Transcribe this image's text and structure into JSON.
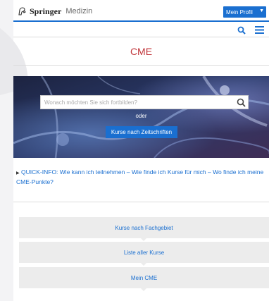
{
  "header": {
    "logo_brand": "Springer",
    "logo_sub": "Medizin",
    "profile_label": "Mein Profil",
    "profile_caret_icon": "caret-down-icon",
    "search_icon": "search-icon",
    "menu_icon": "hamburger-menu-icon"
  },
  "page": {
    "title": "CME"
  },
  "hero": {
    "search_placeholder": "Wonach möchten Sie sich fortbilden?",
    "or_label": "oder",
    "journals_button": "Kurse nach Zeitschriften"
  },
  "quickinfo": {
    "arrow": "▶",
    "text": "QUICK-INFO: Wie kann ich teilnehmen – Wie finde ich Kurse für mich – Wo finde ich meine CME-Punkte?"
  },
  "nav": {
    "items": [
      {
        "label": "Kurse nach Fachgebiet"
      },
      {
        "label": "Liste aller Kurse"
      },
      {
        "label": "Mein CME"
      }
    ]
  },
  "colors": {
    "accent_blue": "#1a6fd0",
    "title_red": "#c0353a",
    "button_gray": "#ececec"
  }
}
